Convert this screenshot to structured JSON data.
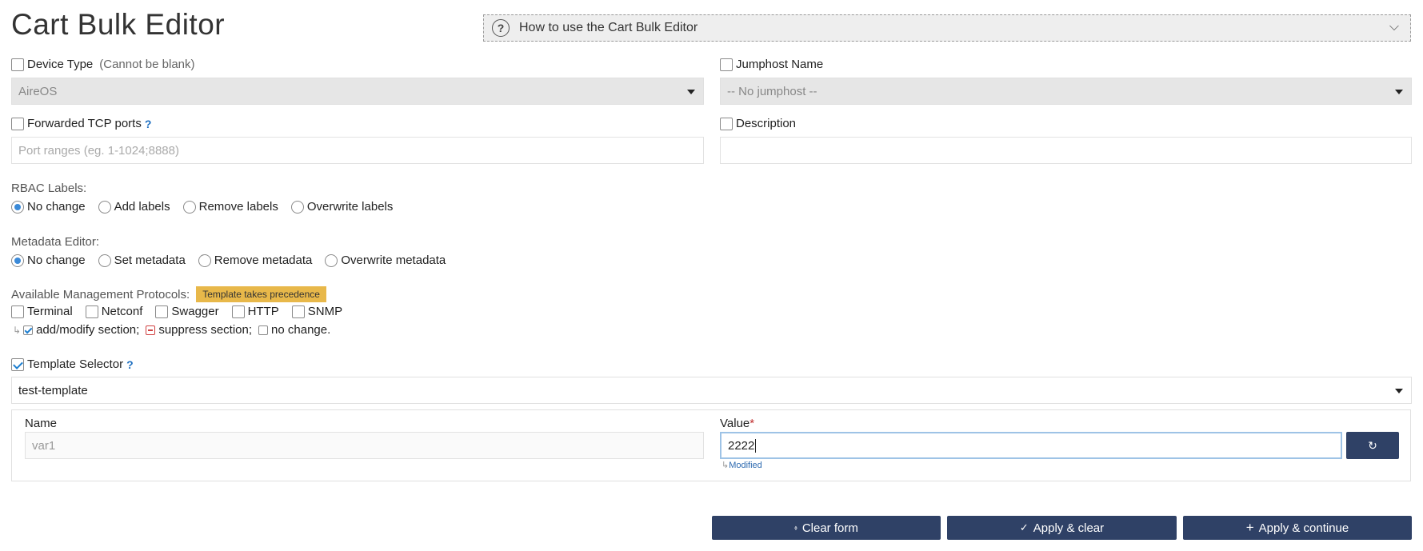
{
  "page": {
    "title": "Cart Bulk Editor",
    "help": {
      "text": "How to use the Cart Bulk Editor",
      "icon": "question-circle-icon"
    }
  },
  "fields": {
    "device_type": {
      "label": "Device Type",
      "hint": "(Cannot be blank)",
      "value": "AireOS",
      "checked": false
    },
    "jumphost": {
      "label": "Jumphost Name",
      "value": "-- No jumphost --",
      "checked": false
    },
    "forwarded_tcp": {
      "label": "Forwarded TCP ports",
      "help": "?",
      "placeholder": "Port ranges (eg. 1-1024;8888)",
      "checked": false
    },
    "description": {
      "label": "Description",
      "value": "",
      "checked": false
    }
  },
  "rbac": {
    "label": "RBAC Labels:",
    "options": [
      "No change",
      "Add labels",
      "Remove labels",
      "Overwrite labels"
    ],
    "selected": "No change"
  },
  "metadata": {
    "label": "Metadata Editor:",
    "options": [
      "No change",
      "Set metadata",
      "Remove metadata",
      "Overwrite metadata"
    ],
    "selected": "No change"
  },
  "protocols": {
    "label": "Available Management Protocols:",
    "badge": "Template takes precedence",
    "items": [
      "Terminal",
      "Netconf",
      "Swagger",
      "HTTP",
      "SNMP"
    ],
    "legend": {
      "add": "add/modify section;",
      "suppress": "suppress section;",
      "nochange": "no change."
    }
  },
  "template": {
    "label": "Template Selector",
    "help": "?",
    "checked": true,
    "value": "test-template",
    "name_header": "Name",
    "value_header": "Value",
    "required_mark": "*",
    "var_name": "var1",
    "var_value": "2222",
    "modified": "Modified"
  },
  "actions": {
    "clear": "Clear form",
    "apply_clear": "Apply & clear",
    "apply_continue": "Apply & continue"
  },
  "colors": {
    "primary": "#2f4166",
    "badge": "#e8b84a",
    "link": "#1e6fc0"
  }
}
